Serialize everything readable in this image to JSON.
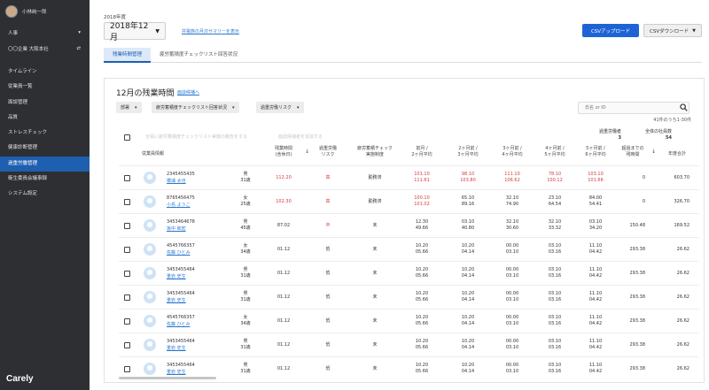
{
  "sidebar": {
    "user_name": "小林純一郎",
    "top_rows": [
      {
        "label": "人事",
        "icon": "chevron-down-icon"
      },
      {
        "label": "〇〇企業 大阪本社",
        "icon": "swap-icon"
      }
    ],
    "nav": [
      {
        "label": "タイムライン",
        "active": false
      },
      {
        "label": "従業員一覧",
        "active": false
      },
      {
        "label": "面談管理",
        "active": false
      },
      {
        "label": "品質",
        "active": false
      },
      {
        "label": "ストレスチェック",
        "active": false
      },
      {
        "label": "健康診断管理",
        "active": false
      },
      {
        "label": "過重労働管理",
        "active": true
      },
      {
        "label": "衛生委員会議事録",
        "active": false
      },
      {
        "label": "システム設定",
        "active": false
      }
    ],
    "logo": "Carely"
  },
  "header": {
    "year_label": "2018年度",
    "month_value": "2018年12月",
    "summary_link": "共電族の月次サマリーを表示",
    "upload_button": "CSVアップロード",
    "download_button": "CSVダウンロード"
  },
  "tabs": [
    {
      "label": "残業時間管理",
      "active": true
    },
    {
      "label": "疲労蓄積度チェックリスト回答状況",
      "active": false
    }
  ],
  "panel": {
    "title": "12月の残業時間",
    "title_link": "面談候補へ",
    "filters": [
      "部署",
      "疲労蓄積度チェックリスト回答状況",
      "過重労働リスク"
    ],
    "search_placeholder": "氏名 or ID",
    "result_count": "41件のうち1-30件",
    "bulk_action_1": "全員に疲労蓄積度チェックリスト実施の報告をする",
    "bulk_action_2": "面談候補者を追加する",
    "stat_1_label": "過重労働者",
    "stat_1_value": "3",
    "stat_2_label": "全体の社員数",
    "stat_2_value": "54"
  },
  "table": {
    "headers": {
      "employee": "従業員情報",
      "overtime": "残業時間\n(含休日)",
      "risk": "過重労働\nリスク",
      "fatigue": "疲労蓄積チェック\n実施制度",
      "m1": "前月 /\n2ヶ月平均",
      "m2": "2ヶ月前 /\n3ヶ月平均",
      "m3": "3ヶ月前 /\n4ヶ月平均",
      "m4": "4ヶ月前 /\n5ヶ月平均",
      "m5": "5ヶ月前 /\n6ヶ月平均",
      "remain": "超過までの\n残時間",
      "total": "年度合計"
    },
    "rows": [
      {
        "id": "2345455435",
        "name": "橋浦 太也",
        "gender": "男",
        "age": "31歳",
        "overtime": "112.20",
        "overtime_red": true,
        "risk": "高",
        "risk_red": true,
        "fatigue": "勤務済",
        "m1": [
          "101.10",
          "111.61"
        ],
        "m1_red": true,
        "m2": [
          "98.10",
          "103.80"
        ],
        "m2_red": true,
        "m3": [
          "111.10",
          "106.62"
        ],
        "m3_red": true,
        "m4": [
          "78.10",
          "100.12"
        ],
        "m4_red": true,
        "m5": [
          "103.10",
          "101.66"
        ],
        "m5_red": true,
        "remain": "0",
        "total": "603.70"
      },
      {
        "id": "8765456475",
        "name": "小島 ようこ",
        "gender": "女",
        "age": "25歳",
        "overtime": "102.30",
        "overtime_red": true,
        "risk": "高",
        "risk_red": true,
        "fatigue": "勤務済",
        "m1": [
          "100.10",
          "101.02"
        ],
        "m1_red": true,
        "m2": [
          "65.10",
          "89.16"
        ],
        "m2_red": false,
        "m3": [
          "32.10",
          "74.90"
        ],
        "m3_red": false,
        "m4": [
          "23.10",
          "64.54"
        ],
        "m4_red": false,
        "m5": [
          "84.00",
          "54.41"
        ],
        "m5_red": false,
        "remain": "0",
        "total": "326.70"
      },
      {
        "id": "3453464678",
        "name": "坂中 和宏",
        "gender": "男",
        "age": "45歳",
        "overtime": "87.02",
        "overtime_red": false,
        "risk": "中",
        "risk_red": true,
        "fatigue": "未",
        "m1": [
          "12.30",
          "49.66"
        ],
        "m1_red": false,
        "m2": [
          "03.10",
          "40.80"
        ],
        "m2_red": false,
        "m3": [
          "32.10",
          "30.60"
        ],
        "m3_red": false,
        "m4": [
          "32.10",
          "33.32"
        ],
        "m4_red": false,
        "m5": [
          "03.10",
          "34.20"
        ],
        "m5_red": false,
        "remain": "150.48",
        "total": "169.52"
      },
      {
        "id": "4545766357",
        "name": "佐藤 ひとみ",
        "gender": "女",
        "age": "34歳",
        "overtime": "01.12",
        "overtime_red": false,
        "risk": "低",
        "risk_red": false,
        "fatigue": "未",
        "m1": [
          "10.20",
          "05.66"
        ],
        "m1_red": false,
        "m2": [
          "10.20",
          "04.14"
        ],
        "m2_red": false,
        "m3": [
          "00.00",
          "03.10"
        ],
        "m3_red": false,
        "m4": [
          "03.10",
          "03.16"
        ],
        "m4_red": false,
        "m5": [
          "11.10",
          "04.42"
        ],
        "m5_red": false,
        "remain": "293.38",
        "total": "26.62"
      },
      {
        "id": "3453455464",
        "name": "重岩 史生",
        "gender": "男",
        "age": "31歳",
        "overtime": "01.12",
        "overtime_red": false,
        "risk": "低",
        "risk_red": false,
        "fatigue": "未",
        "m1": [
          "10.20",
          "05.66"
        ],
        "m1_red": false,
        "m2": [
          "10.20",
          "04.14"
        ],
        "m2_red": false,
        "m3": [
          "00.00",
          "03.10"
        ],
        "m3_red": false,
        "m4": [
          "03.10",
          "03.16"
        ],
        "m4_red": false,
        "m5": [
          "11.10",
          "04.42"
        ],
        "m5_red": false,
        "remain": "293.38",
        "total": "26.62"
      },
      {
        "id": "3453455464",
        "name": "重岩 史生",
        "gender": "男",
        "age": "31歳",
        "overtime": "01.12",
        "overtime_red": false,
        "risk": "低",
        "risk_red": false,
        "fatigue": "未",
        "m1": [
          "10.20",
          "05.66"
        ],
        "m1_red": false,
        "m2": [
          "10.20",
          "04.14"
        ],
        "m2_red": false,
        "m3": [
          "00.00",
          "03.10"
        ],
        "m3_red": false,
        "m4": [
          "03.10",
          "03.16"
        ],
        "m4_red": false,
        "m5": [
          "11.10",
          "04.42"
        ],
        "m5_red": false,
        "remain": "293.38",
        "total": "26.62"
      },
      {
        "id": "4545766357",
        "name": "佐藤 ひとみ",
        "gender": "女",
        "age": "34歳",
        "overtime": "01.12",
        "overtime_red": false,
        "risk": "低",
        "risk_red": false,
        "fatigue": "未",
        "m1": [
          "10.20",
          "05.66"
        ],
        "m1_red": false,
        "m2": [
          "10.20",
          "04.14"
        ],
        "m2_red": false,
        "m3": [
          "00.00",
          "03.10"
        ],
        "m3_red": false,
        "m4": [
          "03.10",
          "03.16"
        ],
        "m4_red": false,
        "m5": [
          "11.10",
          "04.42"
        ],
        "m5_red": false,
        "remain": "293.38",
        "total": "26.62"
      },
      {
        "id": "3453455464",
        "name": "重岩 史生",
        "gender": "男",
        "age": "31歳",
        "overtime": "01.12",
        "overtime_red": false,
        "risk": "低",
        "risk_red": false,
        "fatigue": "未",
        "m1": [
          "10.20",
          "05.66"
        ],
        "m1_red": false,
        "m2": [
          "10.20",
          "04.14"
        ],
        "m2_red": false,
        "m3": [
          "00.00",
          "03.10"
        ],
        "m3_red": false,
        "m4": [
          "03.10",
          "03.16"
        ],
        "m4_red": false,
        "m5": [
          "11.10",
          "04.42"
        ],
        "m5_red": false,
        "remain": "293.38",
        "total": "26.62"
      },
      {
        "id": "3453455464",
        "name": "重岩 史生",
        "gender": "男",
        "age": "31歳",
        "overtime": "01.12",
        "overtime_red": false,
        "risk": "低",
        "risk_red": false,
        "fatigue": "未",
        "m1": [
          "10.20",
          "05.66"
        ],
        "m1_red": false,
        "m2": [
          "10.20",
          "04.14"
        ],
        "m2_red": false,
        "m3": [
          "00.00",
          "03.10"
        ],
        "m3_red": false,
        "m4": [
          "03.10",
          "03.16"
        ],
        "m4_red": false,
        "m5": [
          "11.10",
          "04.42"
        ],
        "m5_red": false,
        "remain": "293.38",
        "total": "26.62"
      }
    ]
  },
  "colors": {
    "accent": "#1e63d6",
    "danger": "#d23b3b",
    "sidebar": "#2d2f33"
  }
}
